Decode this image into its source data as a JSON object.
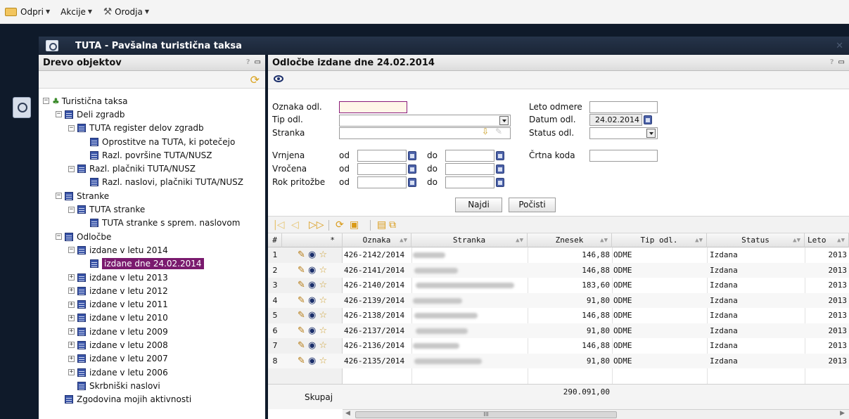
{
  "menu": {
    "items": [
      {
        "label": "Odpri",
        "icon": "folder-open-icon"
      },
      {
        "label": "Akcije",
        "icon": ""
      },
      {
        "label": "Orodja",
        "icon": "tools-icon"
      }
    ]
  },
  "app": {
    "title": "TUTA - Pavšalna turistična taksa",
    "close_symbol": "✕"
  },
  "left_panel": {
    "title": "Drevo objektov",
    "help": "?",
    "minimize": "▭",
    "tree": [
      {
        "label": "Turistična taksa",
        "level": 0,
        "toggle": "−",
        "icon": "tree-icon"
      },
      {
        "label": "Deli zgradb",
        "level": 1,
        "toggle": "−",
        "icon": "table-icon"
      },
      {
        "label": "TUTA register delov zgradb",
        "level": 2,
        "toggle": "−",
        "icon": "table-icon"
      },
      {
        "label": "Oprostitve na TUTA, ki potečejo",
        "level": 3,
        "toggle": "",
        "icon": "table-icon"
      },
      {
        "label": "Razl. površine TUTA/NUSZ",
        "level": 3,
        "toggle": "",
        "icon": "table-icon"
      },
      {
        "label": "Razl. plačniki TUTA/NUSZ",
        "level": 2,
        "toggle": "−",
        "icon": "table-icon"
      },
      {
        "label": "Razl. naslovi, plačniki TUTA/NUSZ",
        "level": 3,
        "toggle": "",
        "icon": "table-icon"
      },
      {
        "label": "Stranke",
        "level": 1,
        "toggle": "−",
        "icon": "table-icon"
      },
      {
        "label": "TUTA stranke",
        "level": 2,
        "toggle": "−",
        "icon": "table-icon"
      },
      {
        "label": "TUTA stranke s sprem. naslovom",
        "level": 3,
        "toggle": "",
        "icon": "table-icon"
      },
      {
        "label": "Odločbe",
        "level": 1,
        "toggle": "−",
        "icon": "table-icon"
      },
      {
        "label": "izdane v letu 2014",
        "level": 2,
        "toggle": "−",
        "icon": "table-icon"
      },
      {
        "label": "izdane dne 24.02.2014",
        "level": 3,
        "toggle": "",
        "icon": "table-icon",
        "selected": true
      },
      {
        "label": "izdane v letu 2013",
        "level": 2,
        "toggle": "+",
        "icon": "table-icon"
      },
      {
        "label": "izdane v letu 2012",
        "level": 2,
        "toggle": "+",
        "icon": "table-icon"
      },
      {
        "label": "izdane v letu 2011",
        "level": 2,
        "toggle": "+",
        "icon": "table-icon"
      },
      {
        "label": "izdane v letu 2010",
        "level": 2,
        "toggle": "+",
        "icon": "table-icon"
      },
      {
        "label": "izdane v letu 2009",
        "level": 2,
        "toggle": "+",
        "icon": "table-icon"
      },
      {
        "label": "izdane v letu 2008",
        "level": 2,
        "toggle": "+",
        "icon": "table-icon"
      },
      {
        "label": "izdane v letu 2007",
        "level": 2,
        "toggle": "+",
        "icon": "table-icon"
      },
      {
        "label": "izdane v letu 2006",
        "level": 2,
        "toggle": "+",
        "icon": "table-icon"
      },
      {
        "label": "Skrbniški naslovi",
        "level": 2,
        "toggle": "",
        "icon": "table-icon"
      },
      {
        "label": "Zgodovina mojih aktivnosti",
        "level": 1,
        "toggle": "",
        "icon": "table-icon"
      }
    ]
  },
  "right_panel": {
    "title": "Odločbe izdane dne 24.02.2014",
    "help": "?",
    "minimize": "▭"
  },
  "form": {
    "oznaka_label": "Oznaka odl.",
    "oznaka_value": "",
    "tip_label": "Tip odl.",
    "tip_value": "",
    "stranka_label": "Stranka",
    "stranka_value": "",
    "leto_label": "Leto odmere",
    "leto_value": "",
    "datum_label": "Datum odl.",
    "datum_value": "24.02.2014",
    "status_label": "Status odl.",
    "status_value": "",
    "vrnjena_label": "Vrnjena",
    "vrocena_label": "Vročena",
    "rok_label": "Rok pritožbe",
    "od_label": "od",
    "do_label": "do",
    "crtna_label": "Črtna koda",
    "crtna_value": "",
    "search_button": "Najdi",
    "clear_button": "Počisti"
  },
  "grid": {
    "columns": [
      "#",
      "*",
      "Oznaka",
      "Stranka",
      "Znesek",
      "Tip odl.",
      "Status",
      "Leto"
    ],
    "rows": [
      {
        "n": "1",
        "oznaka": "426-2142/2014",
        "znesek": "146,88",
        "tip": "ODME",
        "status": "Izdana",
        "leto": "2013"
      },
      {
        "n": "2",
        "oznaka": "426-2141/2014",
        "znesek": "146,88",
        "tip": "ODME",
        "status": "Izdana",
        "leto": "2013"
      },
      {
        "n": "3",
        "oznaka": "426-2140/2014",
        "znesek": "183,60",
        "tip": "ODME",
        "status": "Izdana",
        "leto": "2013"
      },
      {
        "n": "4",
        "oznaka": "426-2139/2014",
        "znesek": "91,80",
        "tip": "ODME",
        "status": "Izdana",
        "leto": "2013"
      },
      {
        "n": "5",
        "oznaka": "426-2138/2014",
        "znesek": "146,88",
        "tip": "ODME",
        "status": "Izdana",
        "leto": "2013"
      },
      {
        "n": "6",
        "oznaka": "426-2137/2014",
        "znesek": "91,80",
        "tip": "ODME",
        "status": "Izdana",
        "leto": "2013"
      },
      {
        "n": "7",
        "oznaka": "426-2136/2014",
        "znesek": "146,88",
        "tip": "ODME",
        "status": "Izdana",
        "leto": "2013"
      },
      {
        "n": "8",
        "oznaka": "426-2135/2014",
        "znesek": "91,80",
        "tip": "ODME",
        "status": "Izdana",
        "leto": "2013"
      }
    ],
    "sum_label": "Skupaj",
    "sum_value": "290.091,00",
    "scroll_thumb": "III"
  },
  "colors": {
    "frame": "#0f1a2a",
    "selection": "#7a1a6e",
    "accent_icon": "#d99a17"
  }
}
